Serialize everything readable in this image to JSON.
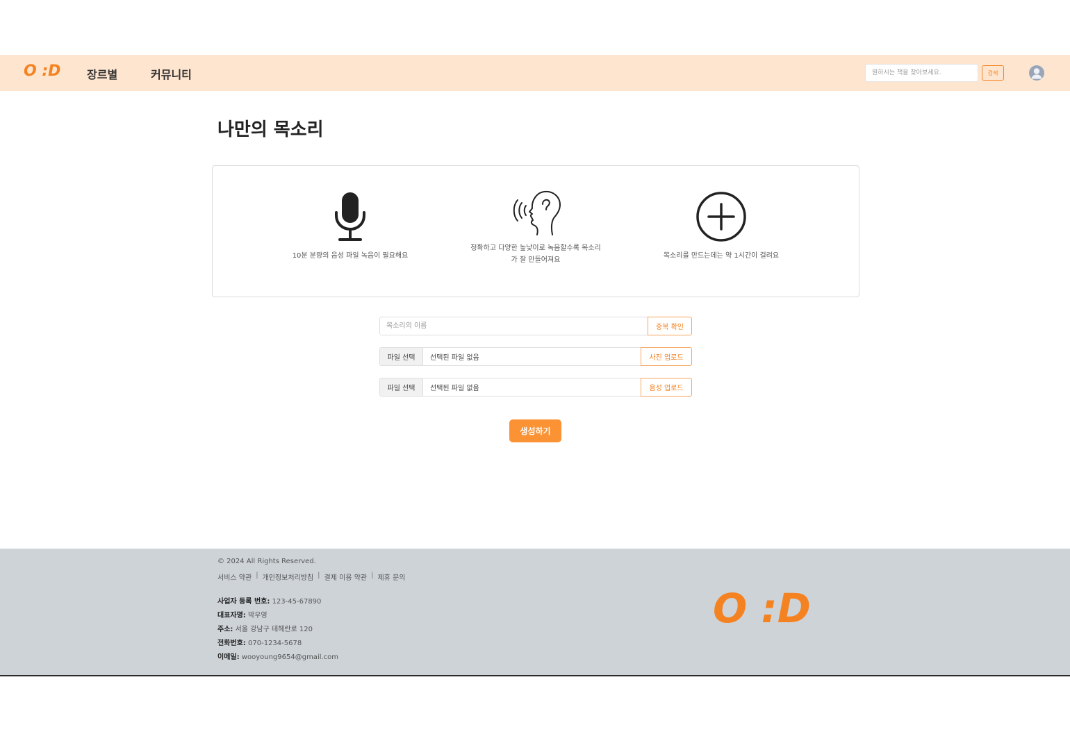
{
  "header": {
    "logo": "O :D",
    "nav": {
      "genre": "장르별",
      "community": "커뮤니티"
    },
    "search": {
      "placeholder": "원하시는 책을 찾아보세요.",
      "button": "검색"
    },
    "avatar_icon": "user-avatar-icon"
  },
  "main": {
    "title": "나만의 목소리",
    "info": [
      {
        "icon": "microphone-icon",
        "lines": [
          "10분 분량의 음성 파일 녹음이 필요해요"
        ]
      },
      {
        "icon": "speaking-head-icon",
        "lines": [
          "정확하고 다양한 높낮이로 녹음할수록 목소리",
          "가 잘 만들어져요"
        ]
      },
      {
        "icon": "plus-circle-icon",
        "lines": [
          "목소리를 만드는데는 약 1시간이 걸려요"
        ]
      }
    ],
    "form": {
      "name_placeholder": "목소리의 이름",
      "check_button": "중복 확인",
      "file_choose": "파일 선택",
      "file_none": "선택된 파일 없음",
      "photo_upload": "사진 업로드",
      "voice_upload": "음성 업로드"
    },
    "create_button": "생성하기"
  },
  "footer": {
    "copyright": "© 2024 All Rights Reserved.",
    "links": [
      "서비스 약관",
      "개인정보처리방침",
      "결제 이용 약관",
      "제휴 문의"
    ],
    "separator": "|",
    "business_label": "사업자 등록 번호:",
    "business_value": "123-45-67890",
    "ceo_label": "대표자명:",
    "ceo_value": "박우영",
    "address_label": "주소:",
    "address_value": "서울 강남구 테헤란로 120",
    "phone_label": "전화번호:",
    "phone_value": "070-1234-5678",
    "email_label": "이메일:",
    "email_value": "wooyoung9654@gmail.com",
    "logo": "O :D"
  },
  "colors": {
    "brand": "#f58220",
    "nav_bg": "#fee5cf",
    "footer_bg": "#ced3d8",
    "button": "#fb9234"
  }
}
